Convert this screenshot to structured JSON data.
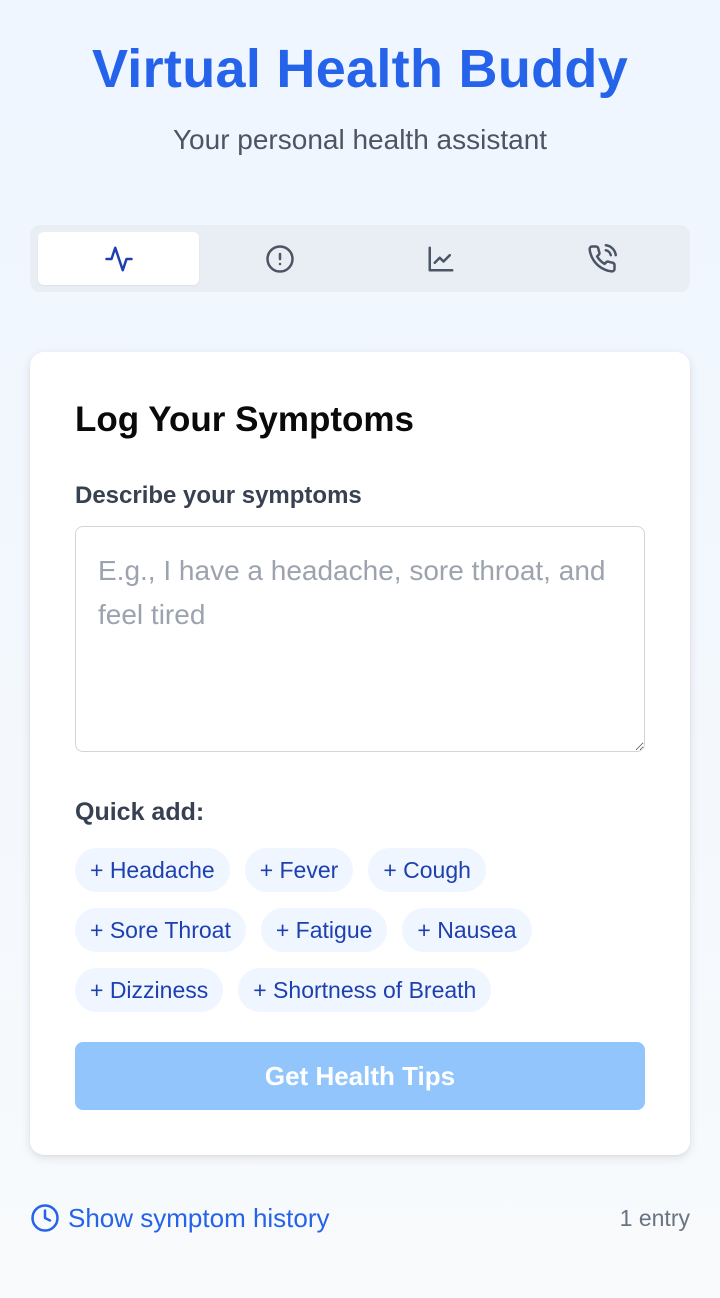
{
  "header": {
    "title": "Virtual Health Buddy",
    "subtitle": "Your personal health assistant"
  },
  "tabs": [
    {
      "icon": "activity-icon",
      "active": true
    },
    {
      "icon": "alert-circle-icon",
      "active": false
    },
    {
      "icon": "line-chart-icon",
      "active": false
    },
    {
      "icon": "phone-call-icon",
      "active": false
    }
  ],
  "card": {
    "title": "Log Your Symptoms",
    "input_label": "Describe your symptoms",
    "input_placeholder": "E.g., I have a headache, sore throat, and feel tired",
    "input_value": "",
    "quick_add_label": "Quick add:",
    "quick_add_chips": [
      "+ Headache",
      "+ Fever",
      "+ Cough",
      "+ Sore Throat",
      "+ Fatigue",
      "+ Nausea",
      "+ Dizziness",
      "+ Shortness of Breath"
    ],
    "submit_label": "Get Health Tips"
  },
  "footer": {
    "history_link": "Show symptom history",
    "history_icon": "clock-icon",
    "entry_count": "1 entry"
  },
  "colors": {
    "accent": "#2563eb",
    "chip_bg": "#eff6ff",
    "chip_text": "#1e40af",
    "button_disabled": "#93c5fd"
  }
}
